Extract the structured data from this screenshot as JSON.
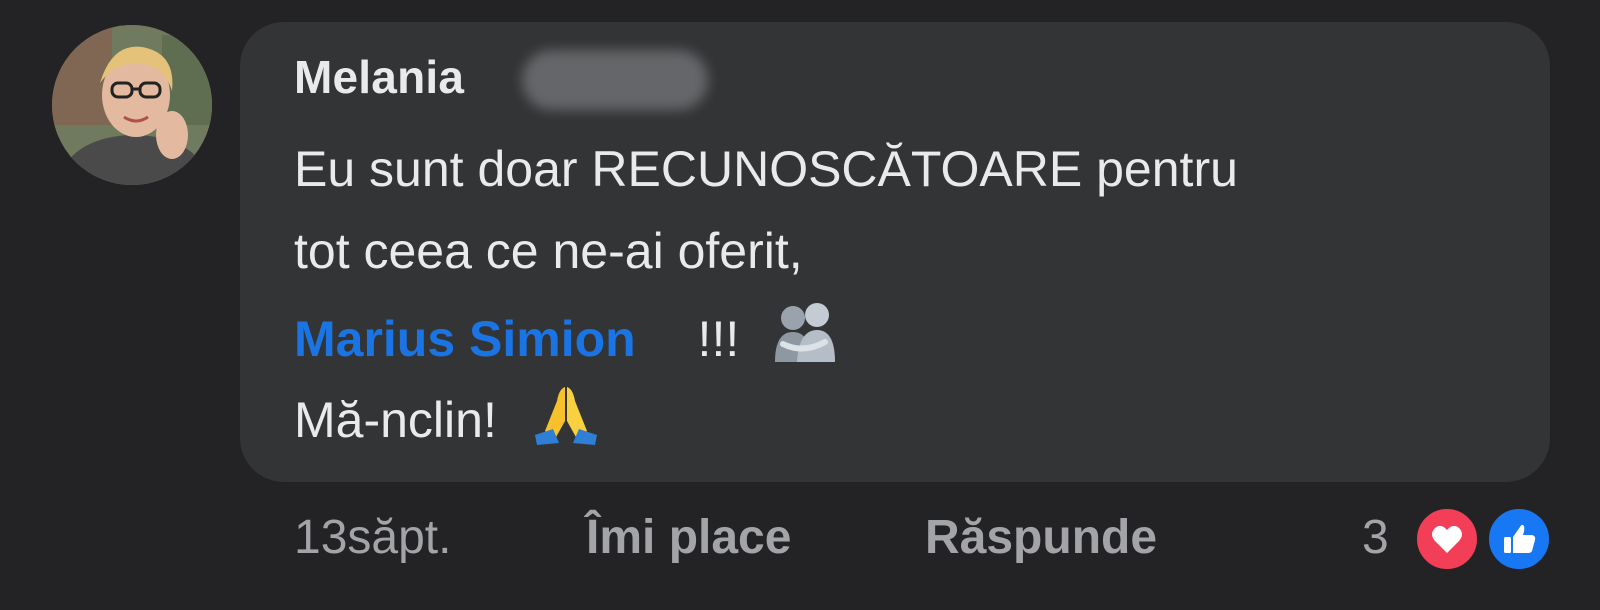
{
  "comment": {
    "author": "Melania",
    "line1": "Eu sunt doar RECUNOSCĂTOARE pentru",
    "line2": "tot ceea ce ne-ai oferit,",
    "mention": "Marius Simion",
    "line3_suffix": "!!!",
    "line4": "Mă-nclin!"
  },
  "meta": {
    "time": "13săpt.",
    "like_label": "Îmi place",
    "reply_label": "Răspunde",
    "reaction_count": "3"
  },
  "icons": {
    "avatar": "user-avatar-photo",
    "hug": "people-hugging-emoji",
    "pray": "folded-hands-emoji",
    "love": "heart-reaction-icon",
    "like": "thumbs-up-reaction-icon"
  },
  "colors": {
    "background": "#232325",
    "bubble": "#333436",
    "mention": "#1b74e4",
    "love": "#f33e58",
    "like": "#1877f2"
  }
}
